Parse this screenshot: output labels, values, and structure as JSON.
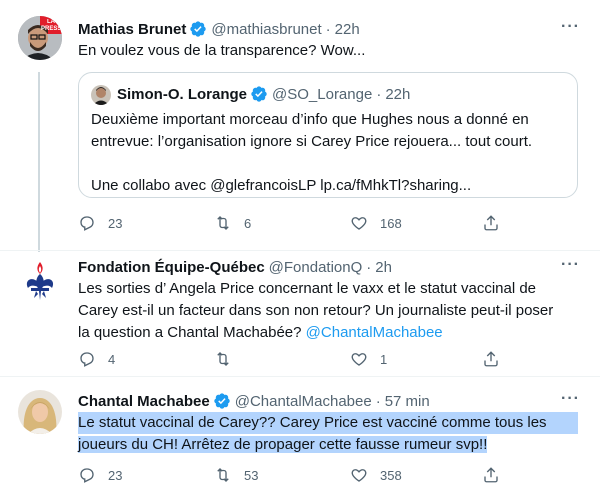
{
  "tweets": [
    {
      "name": "Mathias Brunet",
      "handle": "@mathiasbrunet",
      "dot": "·",
      "time": "22h",
      "more": "···",
      "text": "En voulez vous de la transparence? Wow...",
      "avatar_badge": "LA PRESSE",
      "quote": {
        "name": "Simon-O. Lorange",
        "handle": "@SO_Lorange",
        "dot": "·",
        "time": "22h",
        "lines": [
          "Deuxième important morceau d’info que Hughes nous a donné en",
          "entrevue: l’organisation ignore si Carey Price rejouera... tout court."
        ],
        "footer": "Une collabo avec @glefrancoisLP  lp.ca/fMhkTl?sharing..."
      },
      "actions": {
        "reply": "23",
        "retweet": "6",
        "like": "168"
      }
    },
    {
      "name": "Fondation Équipe-Québec",
      "handle": "@FondationQ",
      "dot": "·",
      "time": "2h",
      "more": "···",
      "lines": [
        "Les sorties d’ Angela Price concernant le vaxx et le statut vaccinal de",
        "Carey est-il un facteur dans son non retour? Un  journaliste peut-il poser",
        "la question a Chantal Machabée? "
      ],
      "mention": "@ChantalMachabee",
      "actions": {
        "reply": "4",
        "retweet": "",
        "like": "1"
      }
    },
    {
      "name": "Chantal Machabee",
      "handle": "@ChantalMachabee",
      "dot": "·",
      "time": "57 min",
      "more": "···",
      "lines": [
        "Le statut vaccinal de Carey?? Carey Price est vacciné comme tous les",
        "joueurs du CH! Arrêtez de propager cette fausse rumeur svp!!"
      ],
      "actions": {
        "reply": "23",
        "retweet": "53",
        "like": "358"
      }
    }
  ],
  "colors": {
    "accent": "#1d9bf0",
    "secondary_text": "#536471",
    "highlight": "#b3d4fd",
    "fleur_de_lis": "#1e3a8a",
    "flame": "#e11d2a"
  },
  "icons": [
    "verified-badge-icon",
    "reply-icon",
    "retweet-icon",
    "like-icon",
    "share-icon",
    "more-icon"
  ]
}
